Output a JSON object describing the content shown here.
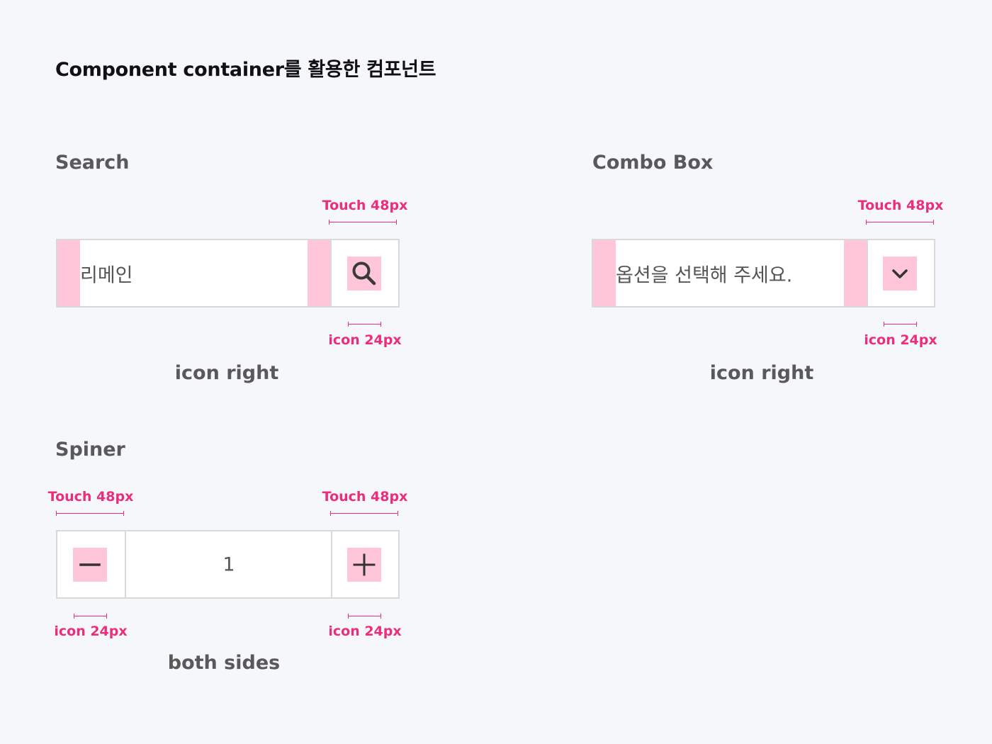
{
  "page": {
    "title": "Component container를 활용한 컴포넌트"
  },
  "colors": {
    "background": "#f6f7fb",
    "annotation": "#ea2e7c",
    "highlight": "#ffc5d8",
    "border": "#d9d9d9",
    "heading": "#595959"
  },
  "search": {
    "title": "Search",
    "value": "리메인",
    "touch_label": "Touch 48px",
    "icon_label": "icon 24px",
    "caption": "icon right",
    "icon": "search-icon"
  },
  "combo": {
    "title": "Combo Box",
    "placeholder": "옵션을 선택해 주세요.",
    "touch_label": "Touch 48px",
    "icon_label": "icon 24px",
    "caption": "icon right",
    "icon": "chevron-down-icon"
  },
  "spinner": {
    "title": "Spiner",
    "value": "1",
    "touch_left_label": "Touch 48px",
    "touch_right_label": "Touch 48px",
    "icon_left_label": "icon 24px",
    "icon_right_label": "icon 24px",
    "caption": "both sides",
    "icon_left": "minus-icon",
    "icon_right": "plus-icon"
  }
}
